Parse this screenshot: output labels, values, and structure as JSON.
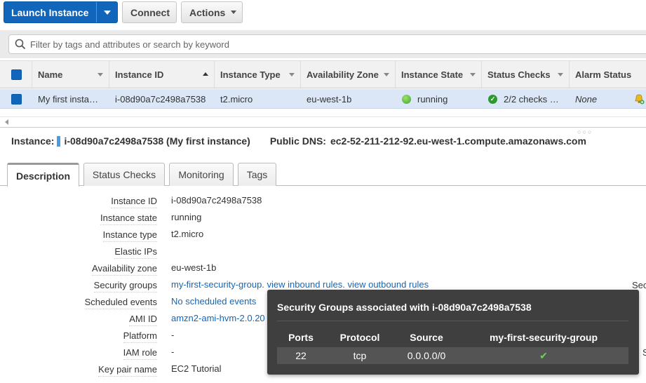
{
  "toolbar": {
    "launch_label": "Launch Instance",
    "connect_label": "Connect",
    "actions_label": "Actions"
  },
  "filter": {
    "placeholder": "Filter by tags and attributes or search by keyword"
  },
  "table": {
    "columns": [
      "Name",
      "Instance ID",
      "Instance Type",
      "Availability Zone",
      "Instance State",
      "Status Checks",
      "Alarm Status"
    ],
    "row": {
      "name": "My first insta…",
      "instance_id": "i-08d90a7c2498a7538",
      "instance_type": "t2.micro",
      "availability_zone": "eu-west-1b",
      "instance_state": "running",
      "status_checks": "2/2 checks …",
      "alarm_status": "None"
    }
  },
  "instance_header": {
    "instance_label": "Instance:",
    "instance_value": "i-08d90a7c2498a7538 (My first instance)",
    "dns_label": "Public DNS:",
    "dns_value": "ec2-52-211-212-92.eu-west-1.compute.amazonaws.com"
  },
  "tabs": [
    "Description",
    "Status Checks",
    "Monitoring",
    "Tags"
  ],
  "description": {
    "instance_id": {
      "label": "Instance ID",
      "value": "i-08d90a7c2498a7538"
    },
    "instance_state": {
      "label": "Instance state",
      "value": "running"
    },
    "instance_type": {
      "label": "Instance type",
      "value": "t2.micro"
    },
    "elastic_ips": {
      "label": "Elastic IPs",
      "value": ""
    },
    "availability_zone": {
      "label": "Availability zone",
      "value": "eu-west-1b"
    },
    "security_groups": {
      "label": "Security groups",
      "group": "my-first-security-group.",
      "inbound": "view inbound rules.",
      "outbound": "view outbound rules"
    },
    "scheduled_events": {
      "label": "Scheduled events",
      "value": "No scheduled events"
    },
    "ami_id": {
      "label": "AMI ID",
      "value": "amzn2-ami-hvm-2.0.20"
    },
    "platform": {
      "label": "Platform",
      "value": "-"
    },
    "iam_role": {
      "label": "IAM role",
      "value": "-"
    },
    "key_pair": {
      "label": "Key pair name",
      "value": "EC2 Tutorial"
    }
  },
  "edge": {
    "sec": "Sec",
    "s": "S"
  },
  "popup": {
    "title": "Security Groups associated with i-08d90a7c2498a7538",
    "headers": [
      "Ports",
      "Protocol",
      "Source",
      "my-first-security-group"
    ],
    "row": {
      "port": "22",
      "protocol": "tcp",
      "source": "0.0.0.0/0",
      "allowed": "✔"
    }
  },
  "colors": {
    "primary": "#1166bb",
    "link": "#1466b8",
    "selected_row": "#dbe7f6",
    "running": "#3ca62a",
    "popup_bg": "#3f3f3f"
  }
}
